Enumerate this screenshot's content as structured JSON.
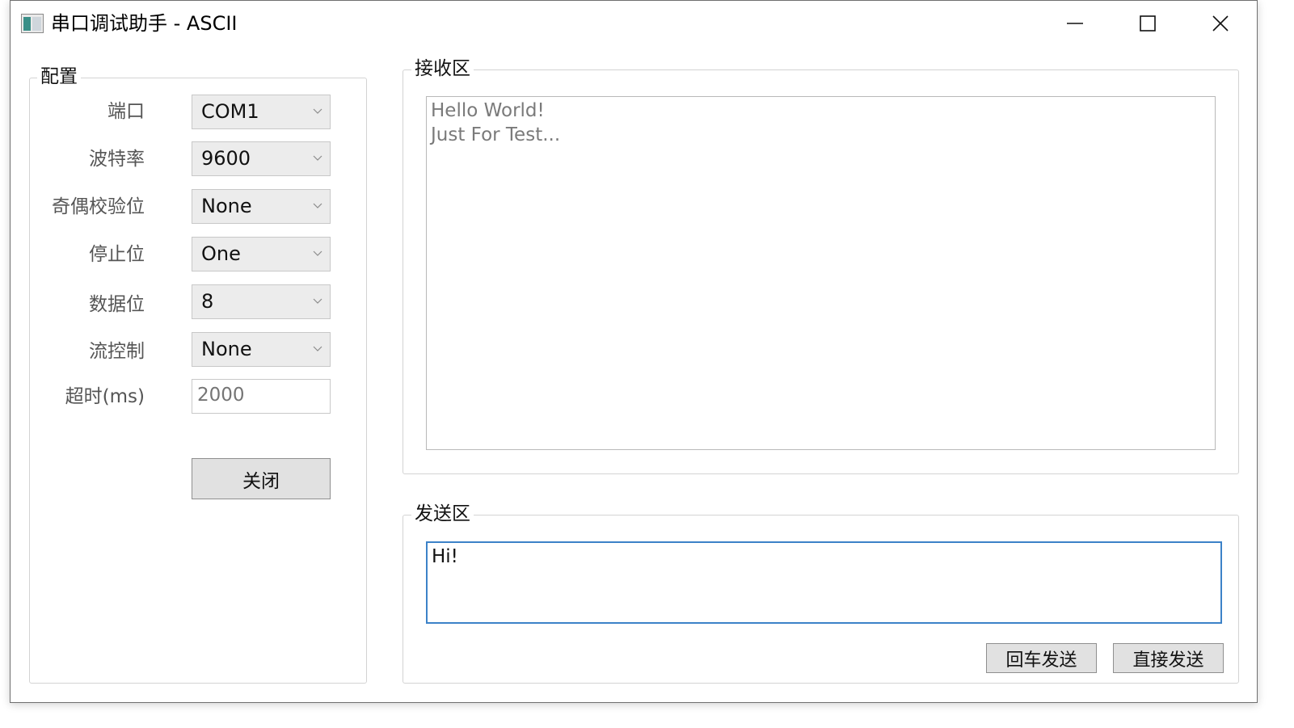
{
  "window": {
    "title": "串口调试助手 - ASCII"
  },
  "config": {
    "title": "配置",
    "port": {
      "label": "端口",
      "value": "COM1"
    },
    "baud": {
      "label": "波特率",
      "value": "9600"
    },
    "parity": {
      "label": "奇偶校验位",
      "value": "None"
    },
    "stopbits": {
      "label": "停止位",
      "value": "One"
    },
    "databits": {
      "label": "数据位",
      "value": "8"
    },
    "flow": {
      "label": "流控制",
      "value": "None"
    },
    "timeout": {
      "label": "超时(ms)",
      "placeholder": "2000"
    },
    "toggle_label": "关闭"
  },
  "receive": {
    "title": "接收区",
    "text": "Hello World!\nJust For Test..."
  },
  "send": {
    "title": "发送区",
    "text": "Hi!",
    "enter_send_label": "回车发送",
    "direct_send_label": "直接发送"
  },
  "icons": {
    "app": "app-icon",
    "minimize": "minimize-icon",
    "maximize": "maximize-icon",
    "close": "close-icon",
    "dropdown": "chevron-down-icon"
  },
  "colors": {
    "focus_border": "#3c82c8",
    "button_bg": "#e1e1e1",
    "window_bg": "#ffffff"
  }
}
